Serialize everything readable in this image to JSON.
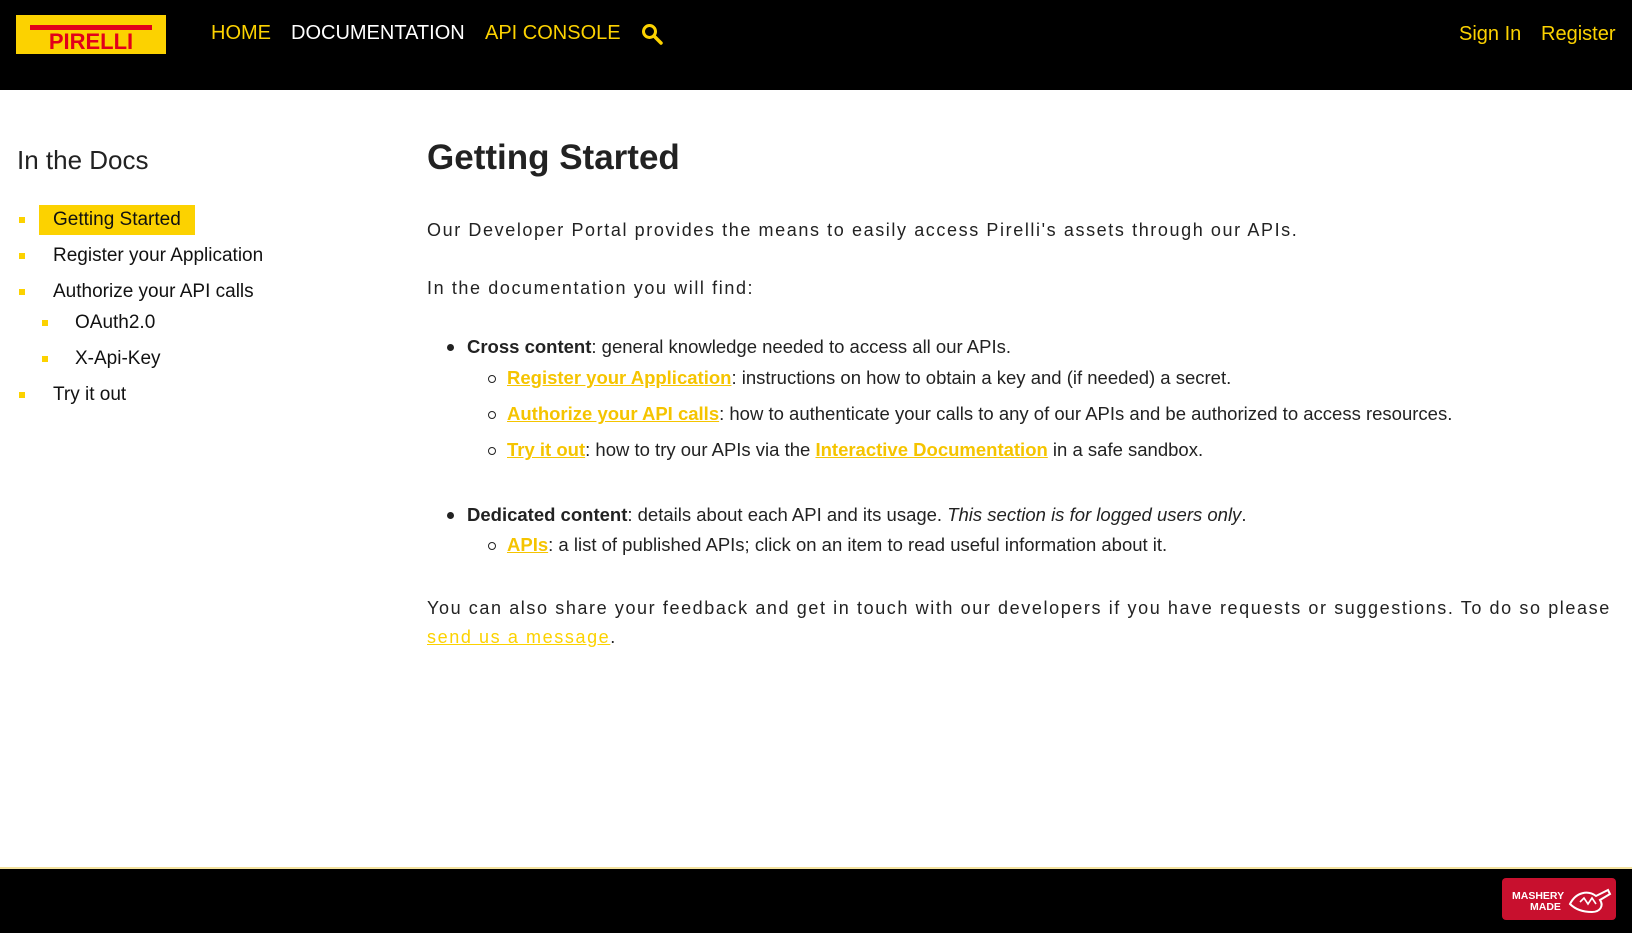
{
  "brand": {
    "logo_text": "PIRELLI"
  },
  "nav": {
    "home": "HOME",
    "documentation": "DOCUMENTATION",
    "api_console": "API CONSOLE",
    "sign_in": "Sign In",
    "register": "Register"
  },
  "sidebar": {
    "title": "In the Docs",
    "items": [
      {
        "label": "Getting Started"
      },
      {
        "label": "Register your Application"
      },
      {
        "label": "Authorize your API calls"
      },
      {
        "label": "OAuth2.0"
      },
      {
        "label": "X-Api-Key"
      },
      {
        "label": "Try it out"
      }
    ]
  },
  "main": {
    "title": "Getting Started",
    "intro": "Our Developer Portal provides the means to easily access Pirelli's assets through our APIs.",
    "find": "In the documentation you will find:",
    "cross": {
      "label": "Cross content",
      "text": ": general knowledge needed to access all our APIs.",
      "items": [
        {
          "link": "Register your Application",
          "text": ": instructions on how to obtain a key and (if needed) a secret."
        },
        {
          "link": "Authorize your API calls",
          "text": ": how to authenticate your calls to any of our APIs and be authorized to access resources."
        },
        {
          "link": "Try it out",
          "text": ": how to try our APIs via the ",
          "link2": "Interactive Documentation",
          "text2": " in a safe sandbox."
        }
      ]
    },
    "dedicated": {
      "label": "Dedicated content",
      "text": ": details about each API and its usage. ",
      "italic": "This section is for logged users only",
      "end": ".",
      "items": [
        {
          "link": "APIs",
          "text": ": a list of published APIs; click on an item to read useful information about it."
        }
      ]
    },
    "feedback": {
      "text": "You can also share your feedback and get in touch with our developers if you have requests or suggestions. To do so please ",
      "link": "send us a message",
      "end": "."
    }
  },
  "footer": {
    "badge_line1": "MASHERY",
    "badge_line2": "MADE"
  },
  "colors": {
    "accent": "#fcd200",
    "header_bg": "#000000",
    "badge": "#c8102e"
  },
  "icons": {
    "search": "search-icon"
  }
}
